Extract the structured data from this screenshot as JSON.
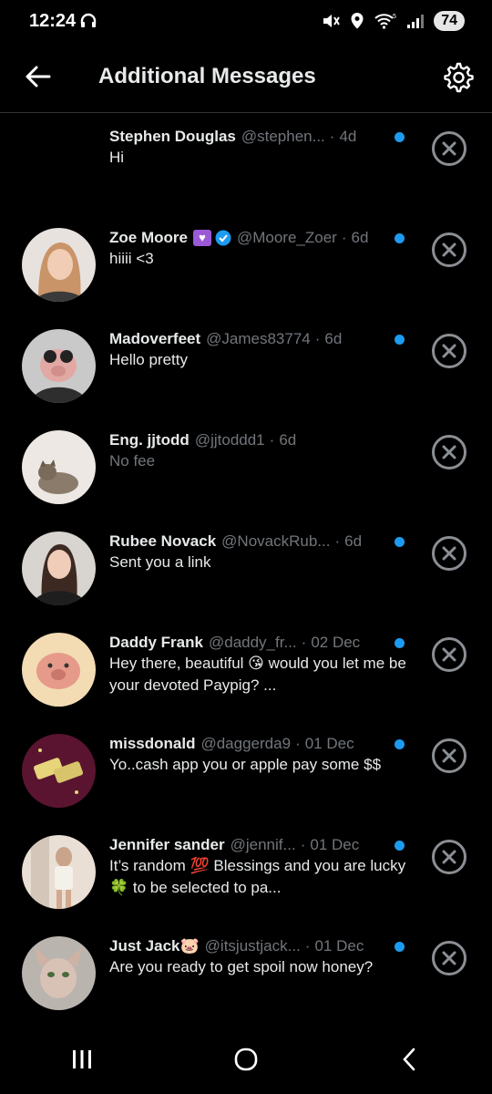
{
  "status": {
    "time": "12:24",
    "battery": "74"
  },
  "header": {
    "title": "Additional Messages"
  },
  "colors": {
    "accent": "#1d9bf0",
    "background": "#000000",
    "muted": "#71767b"
  },
  "messages": [
    {
      "name": "Stephen Douglas",
      "handle": "@stephen...",
      "time": "4d",
      "preview": "Hi",
      "unread": true,
      "avatar": "none"
    },
    {
      "name": "Zoe Moore",
      "handle": "@Moore_Zoer",
      "time": "6d",
      "preview": "hiiii <3",
      "unread": true,
      "avatar": "woman-blonde"
    },
    {
      "name": "Madoverfeet",
      "handle": "@James83774",
      "time": "6d",
      "preview": "Hello pretty",
      "unread": true,
      "avatar": "pig-goggles"
    },
    {
      "name": "Eng. jjtodd",
      "handle": "@jjtoddd1",
      "time": "6d",
      "preview": "No fee",
      "unread": false,
      "avatar": "cat"
    },
    {
      "name": "Rubee Novack",
      "handle": "@NovackRub...",
      "time": "6d",
      "preview": "Sent you a link",
      "unread": true,
      "avatar": "woman-dark"
    },
    {
      "name": "Daddy Frank",
      "handle": "@daddy_fr...",
      "time": "02 Dec",
      "preview": "Hey there, beautiful 😘 would you let me be your devoted Paypig? ...",
      "unread": true,
      "avatar": "paypig"
    },
    {
      "name": "missdonald",
      "handle": "@daggerda9",
      "time": "01 Dec",
      "preview": "Yo..cash app you or apple pay some $$",
      "unread": true,
      "avatar": "money"
    },
    {
      "name": "Jennifer sander",
      "handle": "@jennif...",
      "time": "01 Dec",
      "preview": "It’s random 💯 Blessings and you are lucky 🍀 to be selected to pa...",
      "unread": true,
      "avatar": "woman-mirror"
    },
    {
      "name": "Just Jack🐷",
      "handle": "@itsjustjack...",
      "time": "01 Dec",
      "preview": "Are you ready to get spoil now honey?",
      "unread": true,
      "avatar": "sphynx-cat"
    }
  ],
  "separator": "·"
}
